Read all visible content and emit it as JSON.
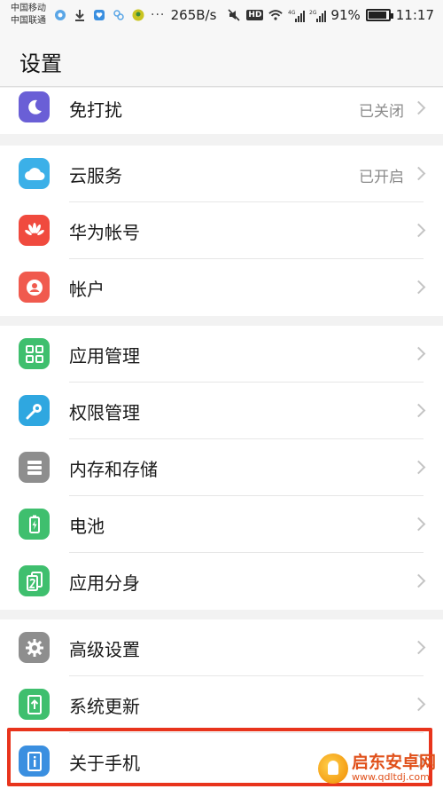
{
  "status_bar": {
    "carrier1": "中国移动",
    "carrier2": "中国联通",
    "speed": "265B/s",
    "signal1": "4G",
    "signal2": "2G",
    "battery": "91%",
    "battery_level": 0.91,
    "time": "11:17",
    "more": "···",
    "hd": "HD"
  },
  "header": {
    "title": "设置"
  },
  "groups": [
    {
      "items": [
        {
          "label": "免打扰",
          "value": "已关闭",
          "icon": "moon-icon",
          "color": "#6a5fd6"
        }
      ]
    },
    {
      "items": [
        {
          "label": "云服务",
          "value": "已开启",
          "icon": "cloud-icon",
          "color": "#3bb0e8"
        },
        {
          "label": "华为帐号",
          "value": "",
          "icon": "huawei-icon",
          "color": "#f04a3e"
        },
        {
          "label": "帐户",
          "value": "",
          "icon": "account-icon",
          "color": "#f05a4e"
        }
      ]
    },
    {
      "items": [
        {
          "label": "应用管理",
          "value": "",
          "icon": "apps-grid-icon",
          "color": "#3fbf6e"
        },
        {
          "label": "权限管理",
          "value": "",
          "icon": "key-icon",
          "color": "#2fa7e0"
        },
        {
          "label": "内存和存储",
          "value": "",
          "icon": "storage-icon",
          "color": "#8e8e8e"
        },
        {
          "label": "电池",
          "value": "",
          "icon": "battery-icon",
          "color": "#3fbf6e"
        },
        {
          "label": "应用分身",
          "value": "",
          "icon": "app-twin-icon",
          "color": "#3fbf6e"
        }
      ]
    },
    {
      "items": [
        {
          "label": "高级设置",
          "value": "",
          "icon": "gear-icon",
          "color": "#8e8e8e"
        },
        {
          "label": "系统更新",
          "value": "",
          "icon": "system-update-icon",
          "color": "#3fbf6e"
        },
        {
          "label": "关于手机",
          "value": "",
          "icon": "about-phone-icon",
          "color": "#3a8fe0"
        }
      ]
    }
  ],
  "watermark": {
    "title": "启东安卓网",
    "url": "www.qdltdj.com"
  }
}
